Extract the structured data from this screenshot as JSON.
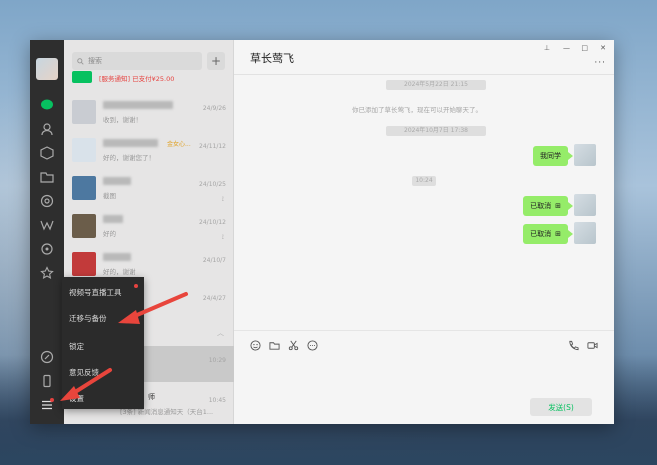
{
  "search": {
    "placeholder": "搜索",
    "add": "+"
  },
  "conversations": [
    {
      "msg": "[服务通知] 已支付¥25.00",
      "time": "",
      "pin": ""
    },
    {
      "msg": "收到，谢谢！",
      "time": "24/9/26",
      "pin": ""
    },
    {
      "msg": "好的，谢谢您了！",
      "time": "24/11/12",
      "tag": "金女心...",
      "pin": ""
    },
    {
      "msg": "截图",
      "time": "24/10/25",
      "pin": "⟟"
    },
    {
      "msg": "好的",
      "time": "24/10/12",
      "pin": "⟟"
    },
    {
      "msg": "好的，谢谢",
      "time": "24/10/7",
      "pin": ""
    },
    {
      "msg": "",
      "time": "24/4/27",
      "pin": ""
    }
  ],
  "selected_conv": {
    "time": "10:29"
  },
  "last_conv": {
    "name": "师",
    "msg": "[3条] 新闻消息通知天（天台1...",
    "time": "10:45"
  },
  "popup_menu": [
    {
      "label": "视频号直播工具",
      "dot": true
    },
    {
      "label": "迁移与备份",
      "dot": false
    },
    {
      "label": "锁定",
      "dot": false
    },
    {
      "label": "意见反馈",
      "dot": false
    },
    {
      "label": "设置",
      "dot": false
    }
  ],
  "chat": {
    "title": "草长莺飞",
    "window_controls": [
      "⊥",
      "—",
      "□",
      "✕"
    ],
    "more": "···",
    "timestamps": [
      "2024年5月22日 21:15",
      "2024年10月7日 17:38",
      "10:24"
    ],
    "system_note": "你已添加了草长莺飞，现在可以开始聊天了。",
    "messages": [
      {
        "text": "我同学",
        "suffix": ""
      },
      {
        "text": "已取消",
        "suffix": "⊞"
      },
      {
        "text": "已取消",
        "suffix": "⊞"
      }
    ],
    "send_label": "发送(S)"
  },
  "colors": {
    "accent_green": "#07c160",
    "bubble_green": "#95ec69",
    "nav_bg": "#2e2e2e",
    "annotation_red": "#e8453c"
  }
}
